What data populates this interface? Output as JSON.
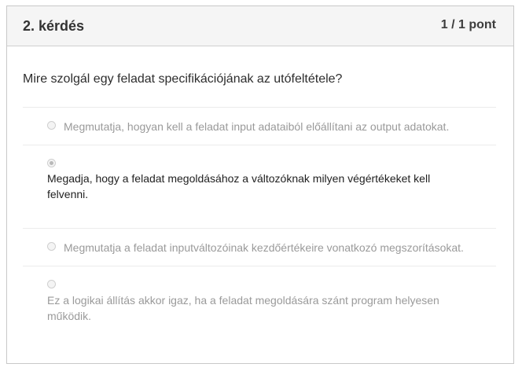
{
  "question": {
    "number_label": "2. kérdés",
    "points": "1 / 1 pont",
    "text": "Mire szolgál egy feladat specifikációjának az utófeltétele?"
  },
  "answers": [
    {
      "label": "Megmutatja, hogyan kell a feladat input adataiból előállítani az output adatokat.",
      "selected": false
    },
    {
      "label": "Megadja, hogy a feladat megoldásához a változóknak milyen végértékeket kell felvenni.",
      "selected": true
    },
    {
      "label": "Megmutatja a feladat inputváltozóinak kezdőértékeire vonatkozó megszorításokat.",
      "selected": false
    },
    {
      "label": "Ez a logikai állítás akkor igaz, ha a feladat megoldására szánt program helyesen működik.",
      "selected": false
    }
  ]
}
